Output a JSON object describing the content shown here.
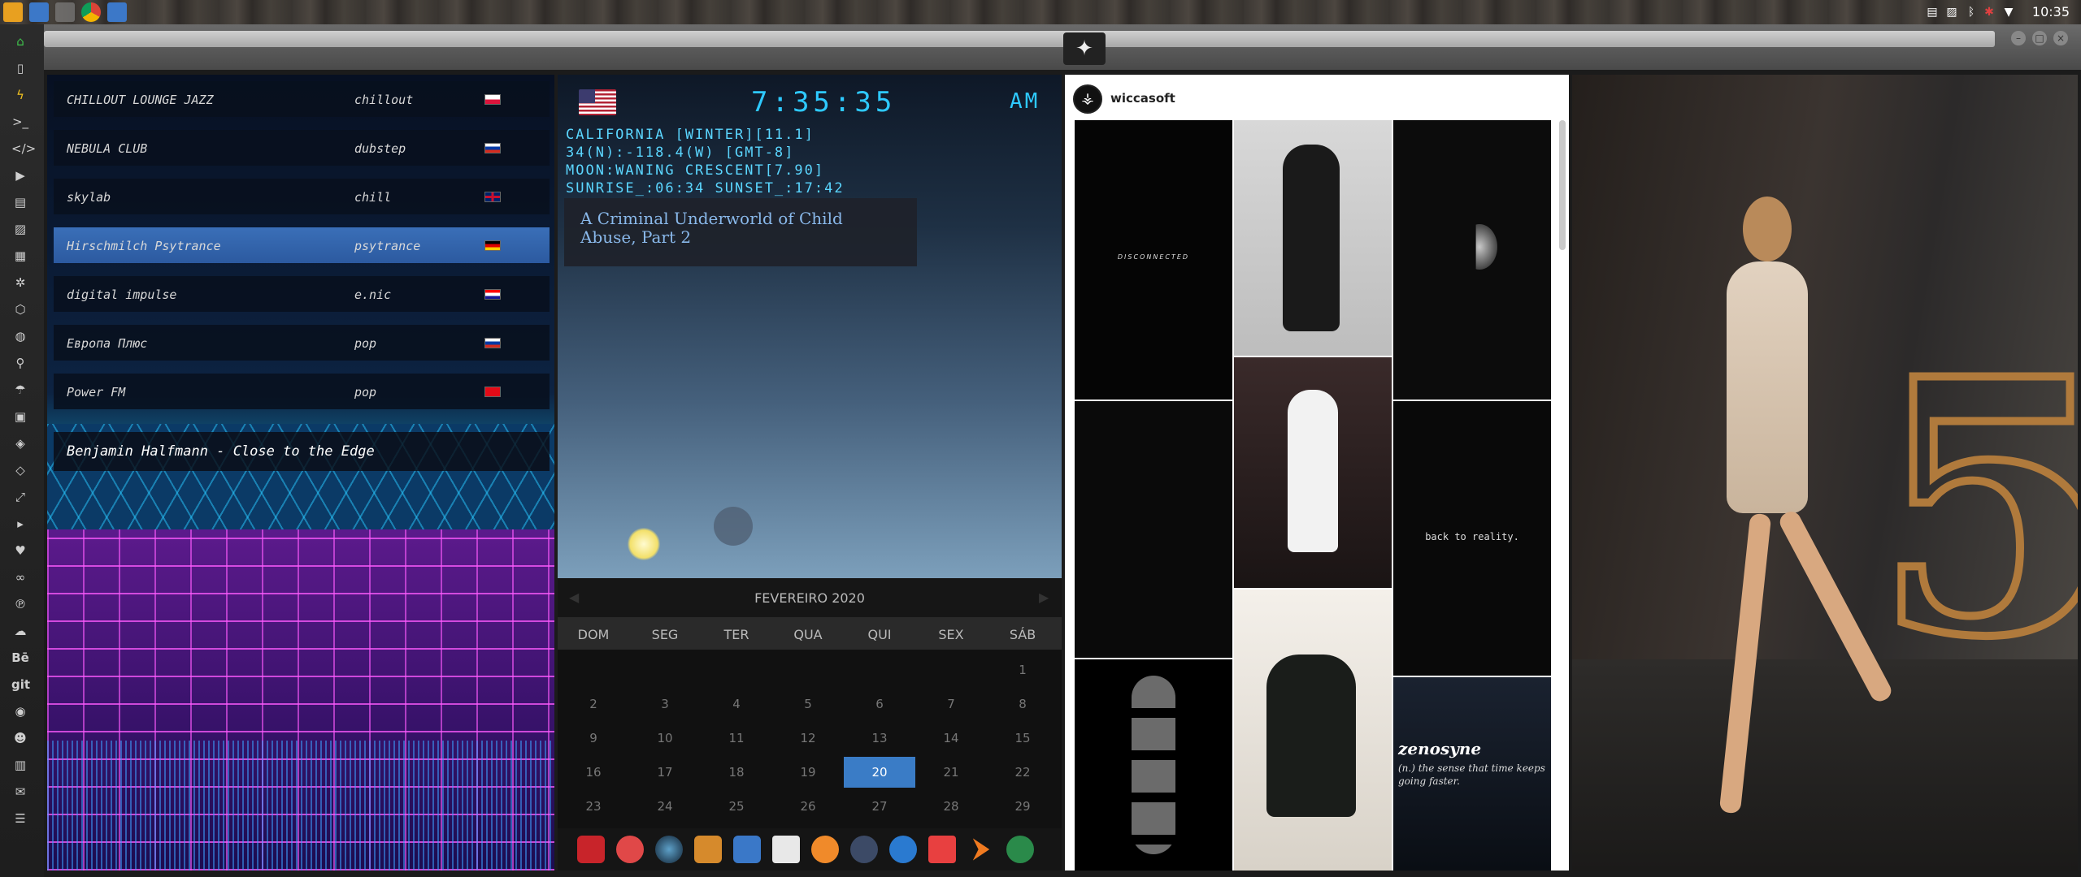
{
  "clock": "10:35",
  "radio": {
    "stations": [
      {
        "name": "CHILLOUT LOUNGE JAZZ",
        "genre": "chillout",
        "flag": "pl"
      },
      {
        "name": "NEBULA CLUB",
        "genre": "dubstep",
        "flag": "ru"
      },
      {
        "name": "skylab",
        "genre": "chill",
        "flag": "gb"
      },
      {
        "name": "Hirschmilch Psytrance",
        "genre": "psytrance",
        "flag": "de",
        "active": true
      },
      {
        "name": "digital impulse",
        "genre": "e.nic",
        "flag": "hr"
      },
      {
        "name": "Европа Плюс",
        "genre": "pop",
        "flag": "ru"
      },
      {
        "name": "Power FM",
        "genre": "pop",
        "flag": "tr"
      }
    ],
    "now_playing": "Benjamin Halfmann - Close to the Edge"
  },
  "weather": {
    "time": "7:35:35",
    "ampm": "AM",
    "line1": "CALIFORNIA [WINTER][11.1]",
    "line2": "34(N):-118.4(W) [GMT-8]",
    "line3": "MOON:WANING CRESCENT[7.90]",
    "line4": "SUNRISE_:06:34 SUNSET_:17:42",
    "headline": "A Criminal Underworld of Child Abuse, Part 2"
  },
  "calendar": {
    "month": "FEVEREIRO 2020",
    "dows": [
      "DOM",
      "SEG",
      "TER",
      "QUA",
      "QUI",
      "SEX",
      "SÁB"
    ],
    "weeks": [
      [
        "",
        "",
        "",
        "",
        "",
        "",
        "1"
      ],
      [
        "2",
        "3",
        "4",
        "5",
        "6",
        "7",
        "8"
      ],
      [
        "9",
        "10",
        "11",
        "12",
        "13",
        "14",
        "15"
      ],
      [
        "16",
        "17",
        "18",
        "19",
        "20",
        "21",
        "22"
      ],
      [
        "23",
        "24",
        "25",
        "26",
        "27",
        "28",
        "29"
      ]
    ],
    "today": "20"
  },
  "instagram": {
    "user": "wiccasoft",
    "tile_texts": {
      "disconnected": "DISCONNECTED",
      "back": "back to reality.",
      "zen_title": "zenosyne",
      "zen_def": "(n.) the sense that time keeps going faster."
    }
  },
  "icons": {
    "sidebar": [
      "home-icon",
      "file-icon",
      "bolt-icon",
      "terminal-icon",
      "code-icon",
      "play-icon",
      "document-icon",
      "image-icon",
      "newspaper-icon",
      "settings-icon",
      "hexagon-icon",
      "globe-icon",
      "search-icon",
      "umbrella-icon",
      "contact-icon",
      "tag-icon",
      "diamond-icon",
      "expand-icon",
      "youtube-icon",
      "heart-icon",
      "lastfm-icon",
      "pinterest-icon",
      "cloud-icon",
      "behance-icon",
      "git-icon",
      "github-icon",
      "reddit-icon",
      "map-icon",
      "mail-icon",
      "menu-icon"
    ]
  },
  "sidebar_text": {
    "behance": "Bē",
    "git": "git"
  }
}
